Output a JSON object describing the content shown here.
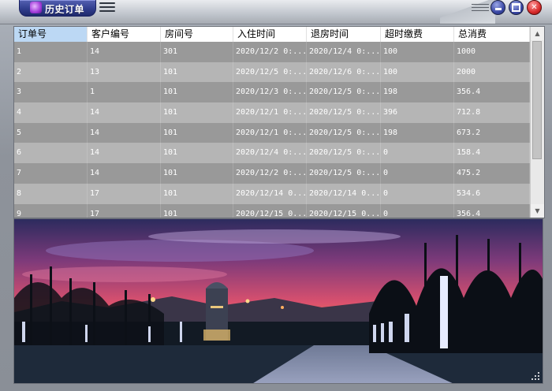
{
  "window": {
    "title": "历史订单",
    "icon": "app-icon",
    "menu_icon": "hamburger-menu-icon",
    "controls": {
      "minimize": "minimize-icon",
      "maximize": "maximize-icon",
      "close": "close-icon",
      "close_glyph": "✕"
    }
  },
  "table": {
    "columns": [
      "订单号",
      "客户编号",
      "房间号",
      "入住时间",
      "退房时间",
      "超时缴费",
      "总消费"
    ],
    "selected_column": 0,
    "rows": [
      [
        "1",
        "14",
        "301",
        "2020/12/2 0:...",
        "2020/12/4 0:...",
        "100",
        "1000"
      ],
      [
        "2",
        "13",
        "101",
        "2020/12/5 0:...",
        "2020/12/6 0:...",
        "100",
        "2000"
      ],
      [
        "3",
        "1",
        "101",
        "2020/12/3 0:...",
        "2020/12/5 0:...",
        "198",
        "356.4"
      ],
      [
        "4",
        "14",
        "101",
        "2020/12/1 0:...",
        "2020/12/5 0:...",
        "396",
        "712.8"
      ],
      [
        "5",
        "14",
        "101",
        "2020/12/1 0:...",
        "2020/12/5 0:...",
        "198",
        "673.2"
      ],
      [
        "6",
        "14",
        "101",
        "2020/12/4 0:...",
        "2020/12/5 0:...",
        "0",
        "158.4"
      ],
      [
        "7",
        "14",
        "101",
        "2020/12/2 0:...",
        "2020/12/5 0:...",
        "0",
        "475.2"
      ],
      [
        "8",
        "17",
        "101",
        "2020/12/14 0...",
        "2020/12/14 0...",
        "0",
        "534.6"
      ],
      [
        "9",
        "17",
        "101",
        "2020/12/15 0...",
        "2020/12/15 0...",
        "0",
        "356.4"
      ]
    ]
  },
  "scrollbar": {
    "up_icon": "scroll-up-arrow-icon",
    "down_icon": "scroll-down-arrow-icon",
    "up_glyph": "▲",
    "down_glyph": "▼"
  },
  "photo": {
    "colors": {
      "sky_top": "#3a2f6b",
      "sky_mid": "#c24a7a",
      "sky_glow": "#f07a45",
      "ground": "#2a3a4a"
    }
  }
}
